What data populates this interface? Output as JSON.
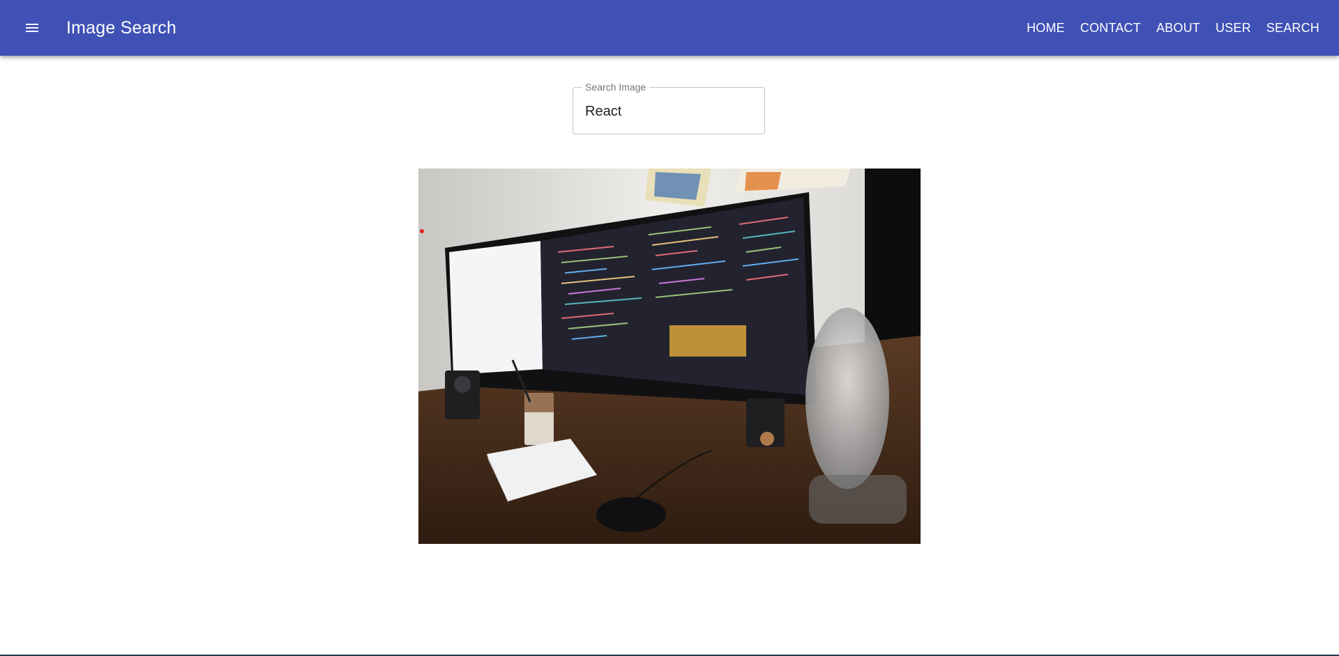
{
  "header": {
    "title": "Image Search",
    "menu_icon": "hamburger-menu-icon",
    "nav": [
      {
        "label": "HOME"
      },
      {
        "label": "CONTACT"
      },
      {
        "label": "ABOUT"
      },
      {
        "label": "USER"
      },
      {
        "label": "SEARCH"
      }
    ],
    "bar_color": "#3f51b5"
  },
  "search": {
    "label": "Search Image",
    "value": "React"
  },
  "result_image": {
    "subject": "desk setup with curved monitor showing code, keyboard, mouse, iced coffee, microphone"
  }
}
